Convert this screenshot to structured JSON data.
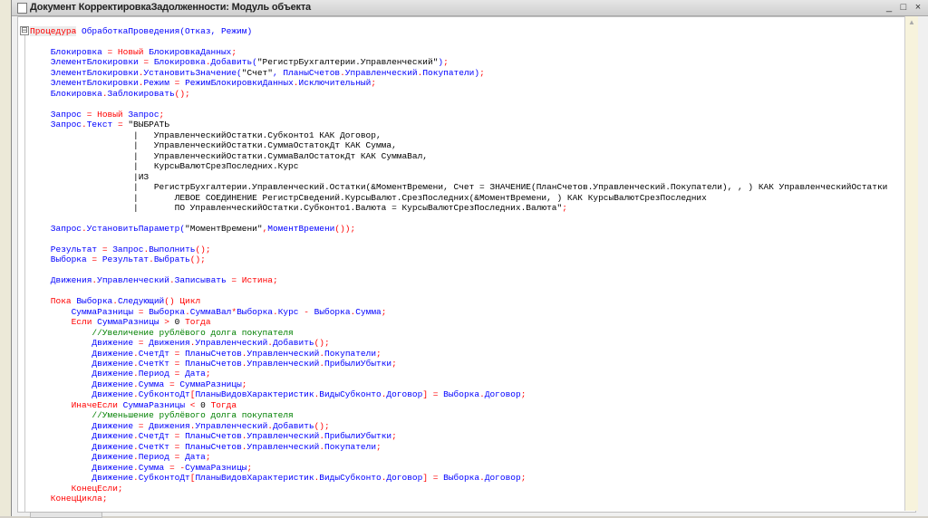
{
  "window": {
    "title": "Документ КорректировкаЗадолженности: Модуль объекта",
    "minimize": "_",
    "maximize": "□",
    "close": "×"
  },
  "editor": {
    "fold_marker": "⊟",
    "scroll_up": "▲"
  },
  "colors": {
    "keyword": "#ff0000",
    "identifier": "#0000ff",
    "literal": "#000000",
    "comment": "#008000"
  },
  "code": {
    "lines": [
      [
        [
          "r",
          "Процедура"
        ],
        [
          "k",
          " "
        ],
        [
          "b",
          "ОбработкаПроведения(Отказ, Режим)"
        ]
      ],
      [],
      [
        [
          "b",
          "    Блокировка "
        ],
        [
          "r",
          "= Новый "
        ],
        [
          "b",
          "БлокировкаДанных"
        ],
        [
          "r",
          ";"
        ]
      ],
      [
        [
          "b",
          "    ЭлементБлокировки "
        ],
        [
          "r",
          "= "
        ],
        [
          "b",
          "Блокировка"
        ],
        [
          "r",
          "."
        ],
        [
          "b",
          "Добавить("
        ],
        [
          "k",
          "\"РегистрБухгалтерии.Управленческий\""
        ],
        [
          "b",
          ")"
        ],
        [
          "r",
          ";"
        ]
      ],
      [
        [
          "b",
          "    ЭлементБлокировки"
        ],
        [
          "r",
          "."
        ],
        [
          "b",
          "УстановитьЗначение("
        ],
        [
          "k",
          "\"Счет\""
        ],
        [
          "b",
          ", ПланыСчетов"
        ],
        [
          "r",
          "."
        ],
        [
          "b",
          "Управленческий"
        ],
        [
          "r",
          "."
        ],
        [
          "b",
          "Покупатели)"
        ],
        [
          "r",
          ";"
        ]
      ],
      [
        [
          "b",
          "    ЭлементБлокировки"
        ],
        [
          "r",
          "."
        ],
        [
          "b",
          "Режим "
        ],
        [
          "r",
          "= "
        ],
        [
          "b",
          "РежимБлокировкиДанных"
        ],
        [
          "r",
          "."
        ],
        [
          "b",
          "Исключительный"
        ],
        [
          "r",
          ";"
        ]
      ],
      [
        [
          "b",
          "    Блокировка"
        ],
        [
          "r",
          "."
        ],
        [
          "b",
          "Заблокировать"
        ],
        [
          "r",
          "();"
        ]
      ],
      [],
      [
        [
          "b",
          "    Запрос "
        ],
        [
          "r",
          "= Новый "
        ],
        [
          "b",
          "Запрос"
        ],
        [
          "r",
          ";"
        ]
      ],
      [
        [
          "b",
          "    Запрос"
        ],
        [
          "r",
          "."
        ],
        [
          "b",
          "Текст "
        ],
        [
          "r",
          "= "
        ],
        [
          "k",
          "\"ВЫБРАТЬ"
        ]
      ],
      [
        [
          "k",
          "                    |   УправленческийОстатки.Субконто1 КАК Договор,"
        ]
      ],
      [
        [
          "k",
          "                    |   УправленческийОстатки.СуммаОстатокДт КАК Сумма,"
        ]
      ],
      [
        [
          "k",
          "                    |   УправленческийОстатки.СуммаВалОстатокДт КАК СуммаВал,"
        ]
      ],
      [
        [
          "k",
          "                    |   КурсыВалютСрезПоследних.Курс"
        ]
      ],
      [
        [
          "k",
          "                    |ИЗ"
        ]
      ],
      [
        [
          "k",
          "                    |   РегистрБухгалтерии.Управленческий.Остатки(&МоментВремени, Счет = ЗНАЧЕНИЕ(ПланСчетов.Управленческий.Покупатели), , ) КАК УправленческийОстатки"
        ]
      ],
      [
        [
          "k",
          "                    |       ЛЕВОЕ СОЕДИНЕНИЕ РегистрСведений.КурсыВалют.СрезПоследних(&МоментВремени, ) КАК КурсыВалютСрезПоследних"
        ]
      ],
      [
        [
          "k",
          "                    |       ПО УправленческийОстатки.Субконто1.Валюта = КурсыВалютСрезПоследних.Валюта\""
        ],
        [
          "r",
          ";"
        ]
      ],
      [],
      [
        [
          "b",
          "    Запрос"
        ],
        [
          "r",
          "."
        ],
        [
          "b",
          "УстановитьПараметр("
        ],
        [
          "k",
          "\"МоментВремени\""
        ],
        [
          "r",
          ","
        ],
        [
          "b",
          "МоментВремени"
        ],
        [
          "r",
          "());"
        ]
      ],
      [],
      [
        [
          "b",
          "    Результат "
        ],
        [
          "r",
          "= "
        ],
        [
          "b",
          "Запрос"
        ],
        [
          "r",
          "."
        ],
        [
          "b",
          "Выполнить"
        ],
        [
          "r",
          "();"
        ]
      ],
      [
        [
          "b",
          "    Выборка "
        ],
        [
          "r",
          "= "
        ],
        [
          "b",
          "Результат"
        ],
        [
          "r",
          "."
        ],
        [
          "b",
          "Выбрать"
        ],
        [
          "r",
          "();"
        ]
      ],
      [],
      [
        [
          "b",
          "    Движения"
        ],
        [
          "r",
          "."
        ],
        [
          "b",
          "Управленческий"
        ],
        [
          "r",
          "."
        ],
        [
          "b",
          "Записывать "
        ],
        [
          "r",
          "= Истина;"
        ]
      ],
      [],
      [
        [
          "r",
          "    Пока "
        ],
        [
          "b",
          "Выборка"
        ],
        [
          "r",
          "."
        ],
        [
          "b",
          "Следующий"
        ],
        [
          "r",
          "() Цикл"
        ]
      ],
      [
        [
          "b",
          "        СуммаРазницы "
        ],
        [
          "r",
          "= "
        ],
        [
          "b",
          "Выборка"
        ],
        [
          "r",
          "."
        ],
        [
          "b",
          "СуммаВал"
        ],
        [
          "r",
          "*"
        ],
        [
          "b",
          "Выборка"
        ],
        [
          "r",
          "."
        ],
        [
          "b",
          "Курс "
        ],
        [
          "r",
          "- "
        ],
        [
          "b",
          "Выборка"
        ],
        [
          "r",
          "."
        ],
        [
          "b",
          "Сумма"
        ],
        [
          "r",
          ";"
        ]
      ],
      [
        [
          "r",
          "        Если "
        ],
        [
          "b",
          "СуммаРазницы "
        ],
        [
          "r",
          "> "
        ],
        [
          "k",
          "0 "
        ],
        [
          "r",
          "Тогда"
        ]
      ],
      [
        [
          "g",
          "            //Увеличение рублёвого долга покупателя"
        ]
      ],
      [
        [
          "b",
          "            Движение "
        ],
        [
          "r",
          "= "
        ],
        [
          "b",
          "Движения"
        ],
        [
          "r",
          "."
        ],
        [
          "b",
          "Управленческий"
        ],
        [
          "r",
          "."
        ],
        [
          "b",
          "Добавить"
        ],
        [
          "r",
          "();"
        ]
      ],
      [
        [
          "b",
          "            Движение"
        ],
        [
          "r",
          "."
        ],
        [
          "b",
          "СчетДт "
        ],
        [
          "r",
          "= "
        ],
        [
          "b",
          "ПланыСчетов"
        ],
        [
          "r",
          "."
        ],
        [
          "b",
          "Управленческий"
        ],
        [
          "r",
          "."
        ],
        [
          "b",
          "Покупатели"
        ],
        [
          "r",
          ";"
        ]
      ],
      [
        [
          "b",
          "            Движение"
        ],
        [
          "r",
          "."
        ],
        [
          "b",
          "СчетКт "
        ],
        [
          "r",
          "= "
        ],
        [
          "b",
          "ПланыСчетов"
        ],
        [
          "r",
          "."
        ],
        [
          "b",
          "Управленческий"
        ],
        [
          "r",
          "."
        ],
        [
          "b",
          "ПрибылиУбытки"
        ],
        [
          "r",
          ";"
        ]
      ],
      [
        [
          "b",
          "            Движение"
        ],
        [
          "r",
          "."
        ],
        [
          "b",
          "Период "
        ],
        [
          "r",
          "= "
        ],
        [
          "b",
          "Дата"
        ],
        [
          "r",
          ";"
        ]
      ],
      [
        [
          "b",
          "            Движение"
        ],
        [
          "r",
          "."
        ],
        [
          "b",
          "Сумма "
        ],
        [
          "r",
          "= "
        ],
        [
          "b",
          "СуммаРазницы"
        ],
        [
          "r",
          ";"
        ]
      ],
      [
        [
          "b",
          "            Движение"
        ],
        [
          "r",
          "."
        ],
        [
          "b",
          "СубконтоДт"
        ],
        [
          "r",
          "["
        ],
        [
          "b",
          "ПланыВидовХарактеристик"
        ],
        [
          "r",
          "."
        ],
        [
          "b",
          "ВидыСубконто"
        ],
        [
          "r",
          "."
        ],
        [
          "b",
          "Договор"
        ],
        [
          "r",
          "] = "
        ],
        [
          "b",
          "Выборка"
        ],
        [
          "r",
          "."
        ],
        [
          "b",
          "Договор"
        ],
        [
          "r",
          ";"
        ]
      ],
      [
        [
          "r",
          "        ИначеЕсли "
        ],
        [
          "b",
          "СуммаРазницы "
        ],
        [
          "r",
          "< "
        ],
        [
          "k",
          "0 "
        ],
        [
          "r",
          "Тогда"
        ]
      ],
      [
        [
          "g",
          "            //Уменьшение рублёвого долга покупателя"
        ]
      ],
      [
        [
          "b",
          "            Движение "
        ],
        [
          "r",
          "= "
        ],
        [
          "b",
          "Движения"
        ],
        [
          "r",
          "."
        ],
        [
          "b",
          "Управленческий"
        ],
        [
          "r",
          "."
        ],
        [
          "b",
          "Добавить"
        ],
        [
          "r",
          "();"
        ]
      ],
      [
        [
          "b",
          "            Движение"
        ],
        [
          "r",
          "."
        ],
        [
          "b",
          "СчетДт "
        ],
        [
          "r",
          "= "
        ],
        [
          "b",
          "ПланыСчетов"
        ],
        [
          "r",
          "."
        ],
        [
          "b",
          "Управленческий"
        ],
        [
          "r",
          "."
        ],
        [
          "b",
          "ПрибылиУбытки"
        ],
        [
          "r",
          ";"
        ]
      ],
      [
        [
          "b",
          "            Движение"
        ],
        [
          "r",
          "."
        ],
        [
          "b",
          "СчетКт "
        ],
        [
          "r",
          "= "
        ],
        [
          "b",
          "ПланыСчетов"
        ],
        [
          "r",
          "."
        ],
        [
          "b",
          "Управленческий"
        ],
        [
          "r",
          "."
        ],
        [
          "b",
          "Покупатели"
        ],
        [
          "r",
          ";"
        ]
      ],
      [
        [
          "b",
          "            Движение"
        ],
        [
          "r",
          "."
        ],
        [
          "b",
          "Период "
        ],
        [
          "r",
          "= "
        ],
        [
          "b",
          "Дата"
        ],
        [
          "r",
          ";"
        ]
      ],
      [
        [
          "b",
          "            Движение"
        ],
        [
          "r",
          "."
        ],
        [
          "b",
          "Сумма "
        ],
        [
          "r",
          "= -"
        ],
        [
          "b",
          "СуммаРазницы"
        ],
        [
          "r",
          ";"
        ]
      ],
      [
        [
          "b",
          "            Движение"
        ],
        [
          "r",
          "."
        ],
        [
          "b",
          "СубконтоДт"
        ],
        [
          "r",
          "["
        ],
        [
          "b",
          "ПланыВидовХарактеристик"
        ],
        [
          "r",
          "."
        ],
        [
          "b",
          "ВидыСубконто"
        ],
        [
          "r",
          "."
        ],
        [
          "b",
          "Договор"
        ],
        [
          "r",
          "] = "
        ],
        [
          "b",
          "Выборка"
        ],
        [
          "r",
          "."
        ],
        [
          "b",
          "Договор"
        ],
        [
          "r",
          ";"
        ]
      ],
      [
        [
          "r",
          "        КонецЕсли;"
        ]
      ],
      [
        [
          "r",
          "    КонецЦикла;"
        ]
      ]
    ]
  }
}
